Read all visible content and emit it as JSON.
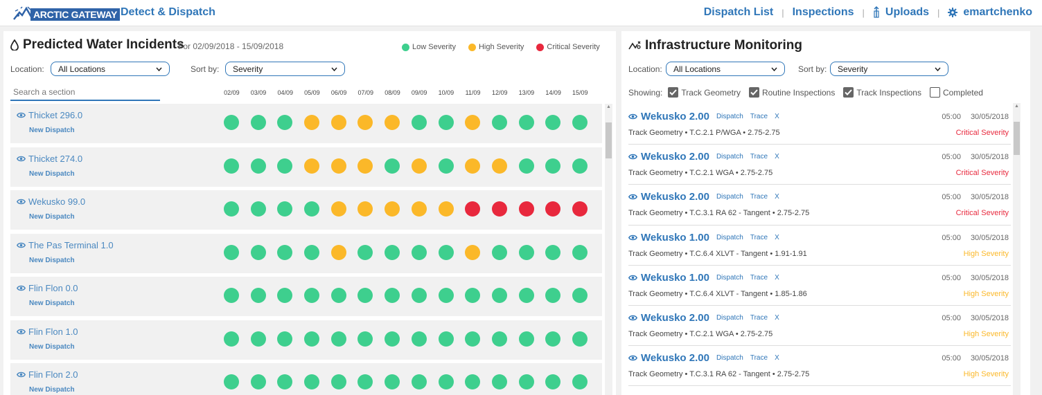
{
  "colors": {
    "accent": "#2f76b8",
    "low": "#3ecf8e",
    "high": "#fbb829",
    "critical": "#e8283d"
  },
  "header": {
    "logo_text": "ARCTIC GATEWAY",
    "app_title": "Detect & Dispatch",
    "nav": {
      "dispatch_list": "Dispatch List",
      "inspections": "Inspections",
      "uploads": "Uploads",
      "user": "emartchenko"
    },
    "separator": "|"
  },
  "left": {
    "title": "Predicted Water Incidents",
    "daterange": "For 02/09/2018 - 15/09/2018",
    "legend": {
      "low": "Low Severity",
      "high": "High Severity",
      "critical": "Critical Severity"
    },
    "location_label": "Location:",
    "location_value": "All Locations",
    "sort_label": "Sort by:",
    "sort_value": "Severity",
    "search_placeholder": "Search a section",
    "dates": [
      "02/09",
      "03/09",
      "04/09",
      "05/09",
      "06/09",
      "07/09",
      "08/09",
      "09/09",
      "10/09",
      "11/09",
      "12/09",
      "13/09",
      "14/09",
      "15/09"
    ],
    "rows": [
      {
        "name": "Thicket 296.0",
        "link": "New Dispatch",
        "severity": [
          "low",
          "low",
          "low",
          "high",
          "high",
          "high",
          "high",
          "low",
          "low",
          "high",
          "low",
          "low",
          "low",
          "low"
        ]
      },
      {
        "name": "Thicket 274.0",
        "link": "New Dispatch",
        "severity": [
          "low",
          "low",
          "low",
          "high",
          "high",
          "high",
          "low",
          "high",
          "low",
          "high",
          "high",
          "low",
          "low",
          "low"
        ]
      },
      {
        "name": "Wekusko 99.0",
        "link": "New Dispatch",
        "severity": [
          "low",
          "low",
          "low",
          "low",
          "high",
          "high",
          "high",
          "high",
          "high",
          "critical",
          "critical",
          "critical",
          "critical",
          "critical"
        ]
      },
      {
        "name": "The Pas Terminal 1.0",
        "link": "New Dispatch",
        "severity": [
          "low",
          "low",
          "low",
          "low",
          "high",
          "low",
          "low",
          "low",
          "low",
          "high",
          "low",
          "low",
          "low",
          "low"
        ]
      },
      {
        "name": "Flin Flon 0.0",
        "link": "New Dispatch",
        "severity": [
          "low",
          "low",
          "low",
          "low",
          "low",
          "low",
          "low",
          "low",
          "low",
          "low",
          "low",
          "low",
          "low",
          "low"
        ]
      },
      {
        "name": "Flin Flon 1.0",
        "link": "New Dispatch",
        "severity": [
          "low",
          "low",
          "low",
          "low",
          "low",
          "low",
          "low",
          "low",
          "low",
          "low",
          "low",
          "low",
          "low",
          "low"
        ]
      },
      {
        "name": "Flin Flon 2.0",
        "link": "New Dispatch",
        "severity": [
          "low",
          "low",
          "low",
          "low",
          "low",
          "low",
          "low",
          "low",
          "low",
          "low",
          "low",
          "low",
          "low",
          "low"
        ]
      }
    ],
    "scroll_position": 0.05
  },
  "right": {
    "title": "Infrastructure Monitoring",
    "location_label": "Location:",
    "location_value": "All Locations",
    "sort_label": "Sort by:",
    "sort_value": "Severity",
    "showing_label": "Showing:",
    "filters": [
      {
        "label": "Track Geometry",
        "checked": true
      },
      {
        "label": "Routine Inspections",
        "checked": true
      },
      {
        "label": "Track Inspections",
        "checked": true
      },
      {
        "label": "Completed",
        "checked": false
      }
    ],
    "actions": {
      "dispatch": "Dispatch",
      "trace": "Trace",
      "close": "X"
    },
    "incidents": [
      {
        "name": "Wekusko 2.00",
        "detail": "Track Geometry • T.C.2.1 P/WGA • 2.75-2.75",
        "time": "05:00",
        "date": "30/05/2018",
        "severity_label": "Critical Severity",
        "severity": "critical"
      },
      {
        "name": "Wekusko 2.00",
        "detail": "Track Geometry • T.C.2.1 WGA • 2.75-2.75",
        "time": "05:00",
        "date": "30/05/2018",
        "severity_label": "Critical Severity",
        "severity": "critical"
      },
      {
        "name": "Wekusko 2.00",
        "detail": "Track Geometry • T.C.3.1 RA 62 - Tangent • 2.75-2.75",
        "time": "05:00",
        "date": "30/05/2018",
        "severity_label": "Critical Severity",
        "severity": "critical"
      },
      {
        "name": "Wekusko 1.00",
        "detail": "Track Geometry • T.C.6.4 XLVT - Tangent • 1.91-1.91",
        "time": "05:00",
        "date": "30/05/2018",
        "severity_label": "High Severity",
        "severity": "high"
      },
      {
        "name": "Wekusko 1.00",
        "detail": "Track Geometry • T.C.6.4 XLVT - Tangent • 1.85-1.86",
        "time": "05:00",
        "date": "30/05/2018",
        "severity_label": "High Severity",
        "severity": "high"
      },
      {
        "name": "Wekusko 2.00",
        "detail": "Track Geometry • T.C.2.1 WGA • 2.75-2.75",
        "time": "05:00",
        "date": "30/05/2018",
        "severity_label": "High Severity",
        "severity": "high"
      },
      {
        "name": "Wekusko 2.00",
        "detail": "Track Geometry • T.C.3.1 RA 62 - Tangent • 2.75-2.75",
        "time": "05:00",
        "date": "30/05/2018",
        "severity_label": "High Severity",
        "severity": "high"
      }
    ],
    "scroll_position": 0.05
  }
}
